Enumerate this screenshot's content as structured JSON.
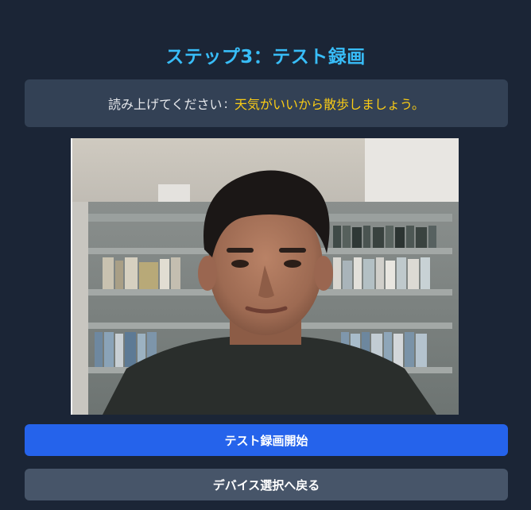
{
  "step": {
    "title": "ステップ3：テスト録画"
  },
  "prompt": {
    "label": "読み上げてください",
    "separator": ":",
    "text": "天気がいいから散歩しましょう。"
  },
  "video": {
    "description": "camera-preview"
  },
  "buttons": {
    "start_recording": "テスト録画開始",
    "back_to_device_select": "デバイス選択へ戻る"
  },
  "colors": {
    "background": "#1b2536",
    "title": "#38bdf8",
    "prompt_box": "#334155",
    "prompt_highlight": "#facc15",
    "primary_button": "#2563eb",
    "secondary_button": "#475569"
  }
}
